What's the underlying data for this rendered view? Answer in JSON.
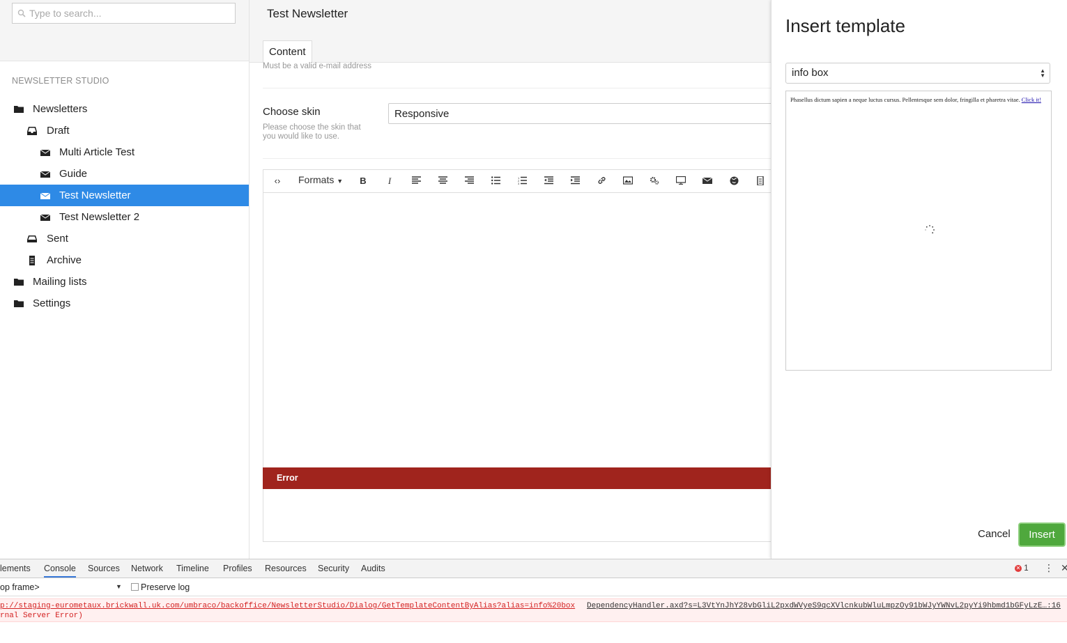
{
  "search": {
    "placeholder": "Type to search..."
  },
  "sidebar": {
    "section_title": "NEWSLETTER STUDIO",
    "items": [
      {
        "label": "Newsletters",
        "icon": "folder-icon"
      },
      {
        "label": "Draft",
        "icon": "inbox-icon"
      },
      {
        "label": "Multi Article Test",
        "icon": "envelope-icon"
      },
      {
        "label": "Guide",
        "icon": "envelope-icon"
      },
      {
        "label": "Test Newsletter",
        "icon": "envelope-icon",
        "selected": true
      },
      {
        "label": "Test Newsletter 2",
        "icon": "envelope-icon"
      },
      {
        "label": "Sent",
        "icon": "inbox-icon"
      },
      {
        "label": "Archive",
        "icon": "archive-icon"
      },
      {
        "label": "Mailing lists",
        "icon": "folder-icon"
      },
      {
        "label": "Settings",
        "icon": "folder-icon"
      }
    ]
  },
  "main": {
    "title": "Test Newsletter",
    "tab": "Content",
    "email_hint": "Must be a valid e-mail address",
    "skin_label": "Choose skin",
    "skin_hint": "Please choose the skin that you would like to use.",
    "skin_value": "Responsive",
    "formats_label": "Formats",
    "error_text": "Error"
  },
  "dialog": {
    "title": "Insert template",
    "template_value": "info box",
    "preview_text": "Phasellus dictum sapien a neque luctus cursus. Pellentesque sem dolor, fringilla et pharetra vitae.",
    "preview_link": "Click it!",
    "cancel_label": "Cancel",
    "insert_label": "Insert"
  },
  "devtools": {
    "tabs": [
      "lements",
      "Console",
      "Sources",
      "Network",
      "Timeline",
      "Profiles",
      "Resources",
      "Security",
      "Audits"
    ],
    "active_tab": "Console",
    "error_count": "1",
    "frame": "op frame>",
    "preserve_log": "Preserve log",
    "log_url": "p://staging-eurometaux.brickwall.uk.com/umbraco/backoffice/NewsletterStudio/Dialog/GetTemplateContentByAlias?alias=info%20box",
    "log_source": "DependencyHandler.axd?s=L3VtYnJhY28vbGliL2pxdWVyeS9qcXVlcnkubWluLmpzOy91bWJyYWNvL2pyYi9hbmd1bGFyLzE…:16",
    "log_line2": "rnal Server Error)"
  },
  "colors": {
    "selected": "#2e8ae6",
    "error_bar": "#a0241d",
    "insert_button": "#4fa83d",
    "console_error": "#d32020"
  }
}
